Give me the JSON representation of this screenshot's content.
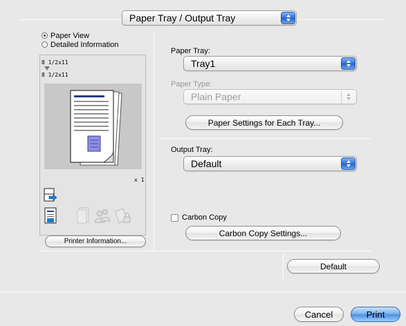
{
  "header": {
    "section_popup": "Paper Tray / Output Tray"
  },
  "preview": {
    "view_options": [
      {
        "label": "Paper View",
        "selected": true
      },
      {
        "label": "Detailed Information",
        "selected": false
      }
    ],
    "paper_size_top": "8 1/2x11",
    "paper_size_bottom": "8 1/2x11",
    "copies": "x 1",
    "printer_info_button": "Printer Information..."
  },
  "paper_tray": {
    "label": "Paper Tray:",
    "value": "Tray1",
    "type_label": "Paper Type:",
    "type_value": "Plain Paper",
    "settings_button": "Paper Settings for Each Tray..."
  },
  "output_tray": {
    "label": "Output Tray:",
    "value": "Default"
  },
  "carbon_copy": {
    "label": "Carbon Copy",
    "checked": false,
    "settings_button": "Carbon Copy Settings..."
  },
  "default_button": "Default",
  "footer": {
    "cancel": "Cancel",
    "print": "Print"
  },
  "colors": {
    "accent": "#3b78d8",
    "background": "#e8e8e8"
  }
}
